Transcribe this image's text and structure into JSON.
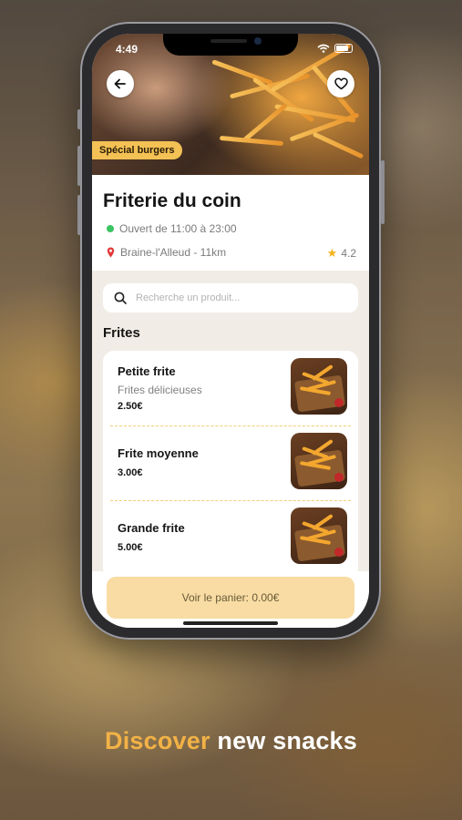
{
  "status_bar": {
    "time": "4:49"
  },
  "hero": {
    "tag": "Spécial burgers"
  },
  "shop": {
    "name": "Friterie du coin",
    "hours": "Ouvert de 11:00 à 23:00",
    "location": "Braine-l'Alleud - 11km",
    "rating": "4.2"
  },
  "search": {
    "placeholder": "Recherche un produit..."
  },
  "section_title": "Frites",
  "products": [
    {
      "name": "Petite frite",
      "description": "Frites délicieuses",
      "price": "2.50€"
    },
    {
      "name": "Frite moyenne",
      "description": "",
      "price": "3.00€"
    },
    {
      "name": "Grande frite",
      "description": "",
      "price": "5.00€"
    }
  ],
  "cart": {
    "label": "Voir le panier: 0.00€"
  },
  "caption": {
    "accent": "Discover",
    "rest": "new snacks"
  },
  "colors": {
    "accent": "#f2b246",
    "tag": "#f3c154",
    "cart_button": "#f8dca3",
    "open_dot": "#3cc463",
    "star": "#f2b41a",
    "pin": "#e23b3b"
  },
  "icons": {
    "back": "arrow-left-icon",
    "favorite": "heart-icon",
    "search": "search-icon",
    "location": "location-pin-icon",
    "rating": "star-icon",
    "open_status": "status-dot-icon"
  }
}
